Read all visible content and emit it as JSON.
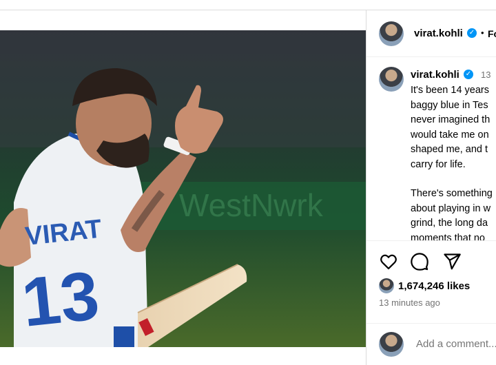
{
  "post": {
    "image_alt": "Virat Kohli in white Test jersey number 13 raising hand, holding bat",
    "jersey_name": "VIRAT",
    "jersey_number": "13"
  },
  "header": {
    "username": "virat.kohli",
    "separator": "•",
    "follow_label": "Fo"
  },
  "caption": {
    "username": "virat.kohli",
    "time_short": "13",
    "lines_para1": [
      "It's been 14 years",
      "baggy blue in Tes",
      "never imagined th",
      "would take me on",
      "shaped me, and t",
      "carry for life."
    ],
    "lines_para2": [
      "There's something",
      "about playing in w",
      "grind, the long da",
      "moments that no"
    ]
  },
  "actions": {
    "likes_count": "1,674,246 likes",
    "post_time": "13 minutes ago"
  },
  "comment": {
    "placeholder": "Add a comment..."
  },
  "colors": {
    "verified": "#0095f6",
    "muted_text": "#737373",
    "border": "#dbdbdb"
  },
  "icons": [
    "heart-icon",
    "comment-icon",
    "share-icon",
    "verified-badge-icon"
  ]
}
